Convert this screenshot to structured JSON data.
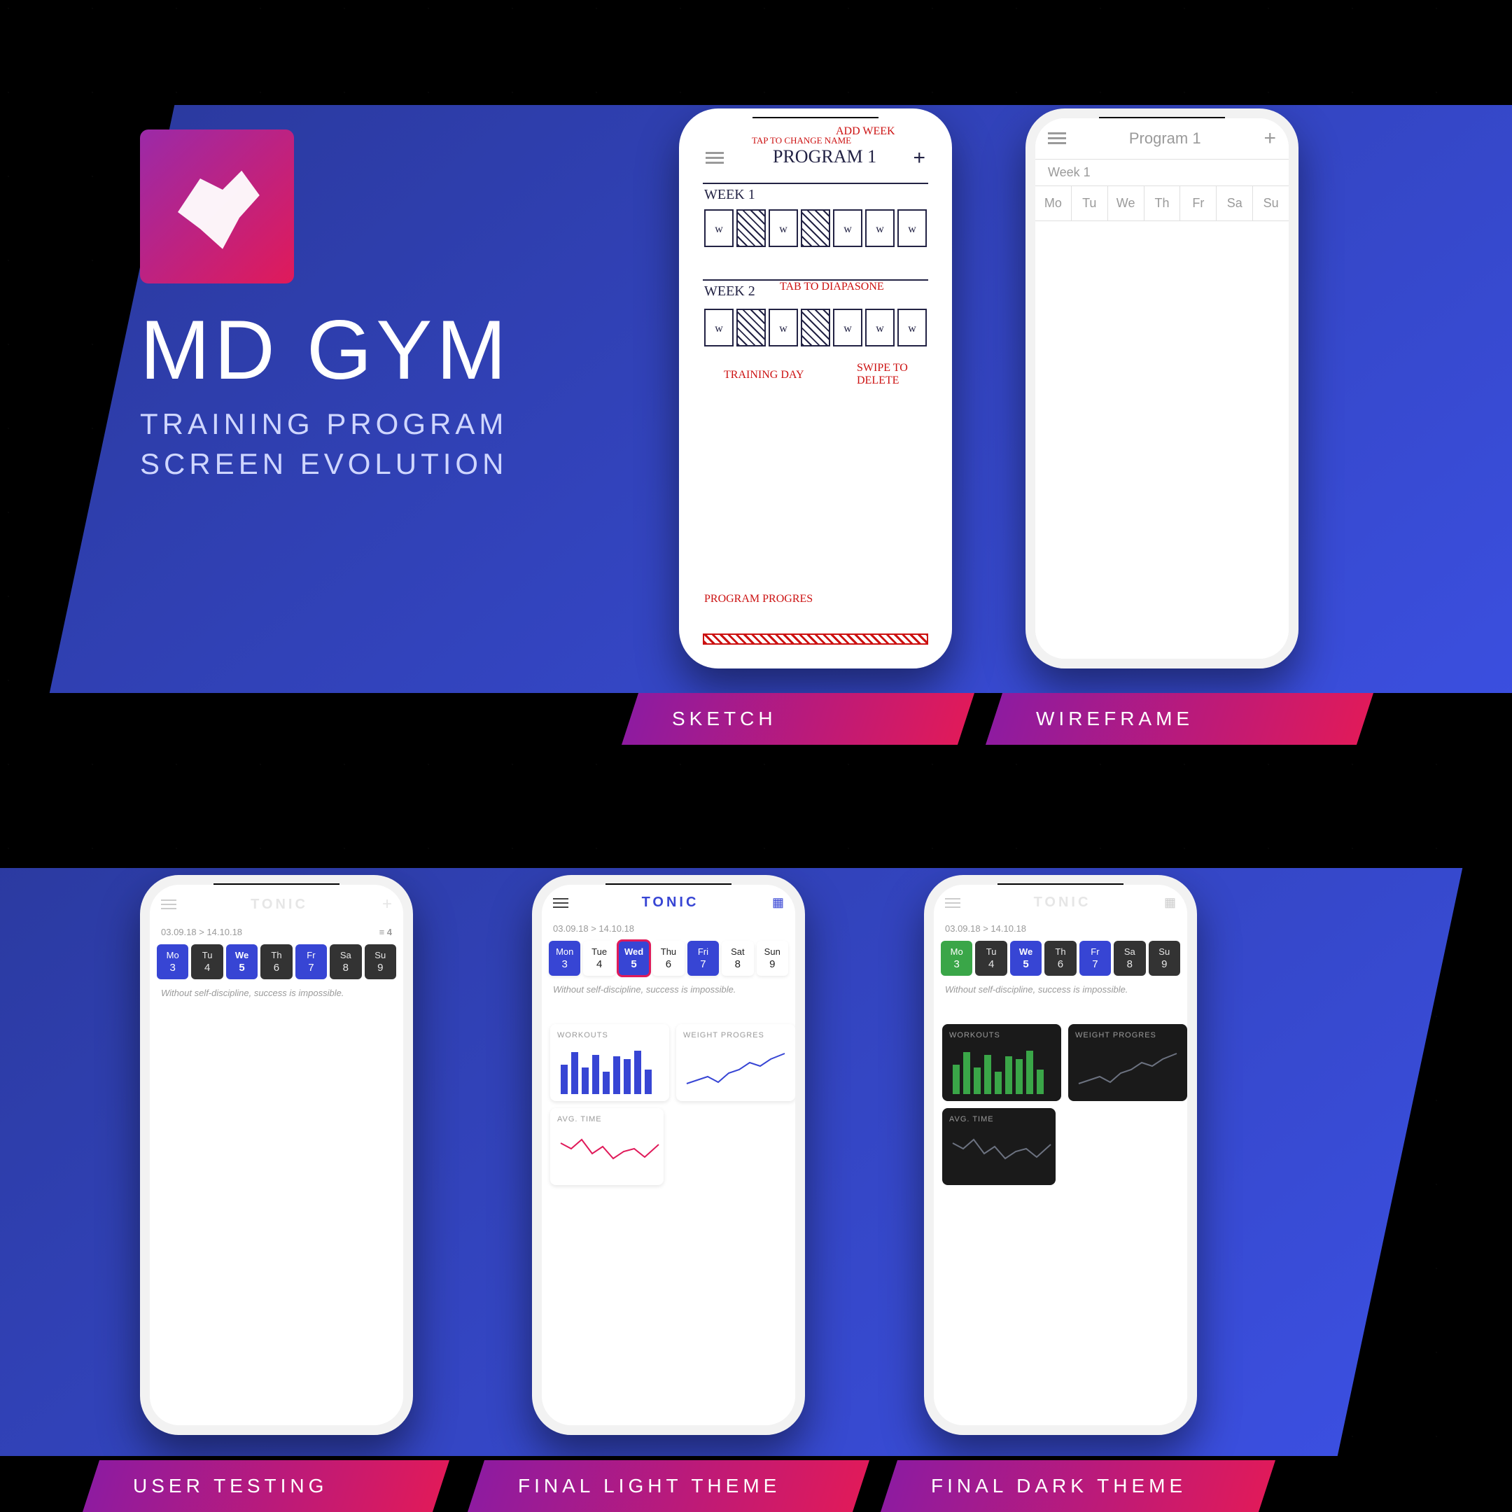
{
  "title": "MD GYM",
  "subtitle_line1": "TRAINING PROGRAM",
  "subtitle_line2": "SCREEN EVOLUTION",
  "stages": {
    "sketch": "SKETCH",
    "wireframe": "WIREFRAME",
    "testing": "USER TESTING",
    "light": "FINAL LIGHT THEME",
    "dark": "FINAL DARK THEME"
  },
  "sketch": {
    "title": "PROGRAM 1",
    "week1": "WEEK 1",
    "week2": "WEEK 2",
    "notes": {
      "add_week": "ADD WEEK",
      "tap_name": "TAP TO CHANGE NAME",
      "tap_diapasone": "TAB TO DIAPASONE",
      "training_day": "TRAINING DAY",
      "swipe_delete": "SWIPE TO DELETE",
      "progress": "PROGRAM PROGRES"
    }
  },
  "wireframe": {
    "title": "Program 1",
    "week": "Week 1",
    "days": [
      "Mo",
      "Tu",
      "We",
      "Th",
      "Fr",
      "Sa",
      "Su"
    ]
  },
  "app": {
    "title": "TONIC",
    "date_range": "03.09.18 > 14.10.18",
    "week_count": "4",
    "quote": "Without self-discipline, success is impossible.",
    "days_short": [
      "Mo",
      "Tu",
      "We",
      "Th",
      "Fr",
      "Sa",
      "Su"
    ],
    "days_long": [
      "Mon",
      "Tue",
      "Wed",
      "Thu",
      "Fri",
      "Sat",
      "Sun"
    ],
    "day_nums": [
      "3",
      "4",
      "5",
      "6",
      "7",
      "8",
      "9"
    ],
    "cards": {
      "workouts": "WORKOUTS",
      "weight": "WEIGHT PROGRES",
      "avg": "AVG. TIME"
    }
  },
  "chart_data": [
    {
      "type": "bar",
      "title": "WORKOUTS",
      "categories": [
        "1",
        "2",
        "3",
        "4",
        "5",
        "6",
        "7",
        "8",
        "9"
      ],
      "values": [
        60,
        85,
        55,
        80,
        45,
        78,
        72,
        88,
        50
      ],
      "ylim": [
        0,
        100
      ]
    },
    {
      "type": "line",
      "title": "WEIGHT PROGRES",
      "x": [
        1,
        2,
        3,
        4,
        5,
        6,
        7,
        8,
        9,
        10
      ],
      "values": [
        20,
        25,
        30,
        22,
        35,
        40,
        50,
        45,
        55,
        60
      ],
      "ylim": [
        0,
        70
      ]
    },
    {
      "type": "line",
      "title": "AVG. TIME",
      "x": [
        1,
        2,
        3,
        4,
        5,
        6,
        7,
        8,
        9,
        10
      ],
      "values": [
        55,
        48,
        60,
        40,
        52,
        35,
        45,
        50,
        38,
        55
      ],
      "ylim": [
        0,
        70
      ]
    }
  ],
  "colors": {
    "accent_magenta": "#e01a5a",
    "accent_purple": "#9b2aa8",
    "band_blue": "#3b4fe0",
    "day_active": "#3745d4",
    "day_outline": "#e01a5a",
    "green": "#3aa648"
  }
}
